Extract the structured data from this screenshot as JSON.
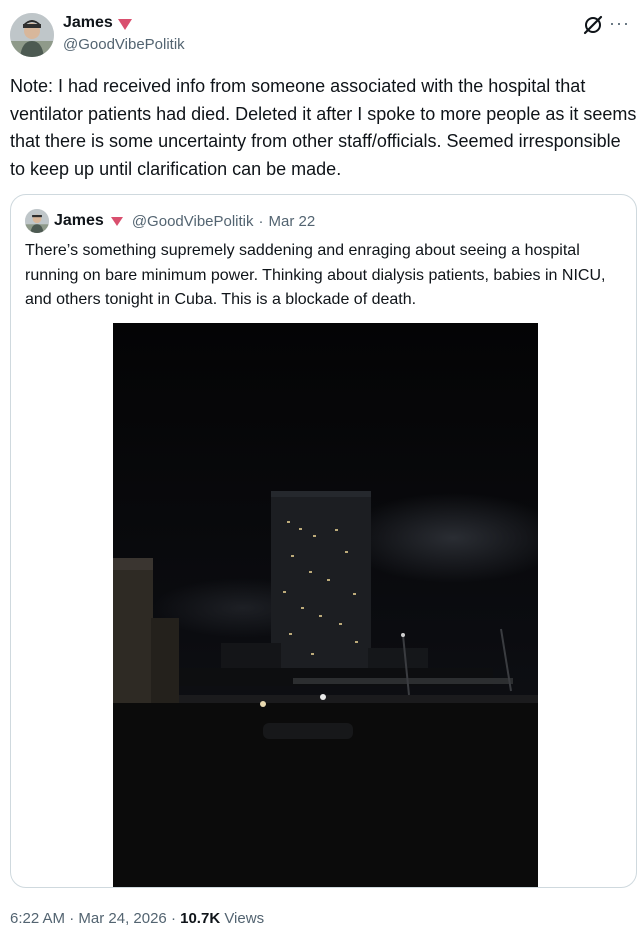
{
  "author": {
    "name": "James",
    "handle": "@GoodVibePolitik"
  },
  "icons": {
    "grok": "grok-icon",
    "more": "more-icon",
    "badge": "pink-triangle-icon",
    "more_glyph": "···"
  },
  "tweet": {
    "text": "Note: I had received info from someone associated with the hospital that ventilator patients had died. Deleted it after I spoke to more people as it seems that there is some uncertainty from other staff/officials. Seemed irresponsible to keep up until clarification can be made."
  },
  "quoted": {
    "name": "James",
    "handle": "@GoodVibePolitik",
    "separator": "·",
    "date": "Mar 22",
    "text": "There’s something supremely saddening and enraging about seeing a hospital running on bare minimum power. Thinking about dialysis patients, babies in NICU, and others tonight in Cuba. This is a blockade of death."
  },
  "footer": {
    "time": "6:22 AM",
    "sep1": "·",
    "date": "Mar 24, 2026",
    "sep2": "·",
    "views_count": "10.7K",
    "views_label": "Views"
  },
  "colors": {
    "badge": "#d94f6e",
    "secondary_text": "#536471",
    "border": "#cfd9de"
  }
}
